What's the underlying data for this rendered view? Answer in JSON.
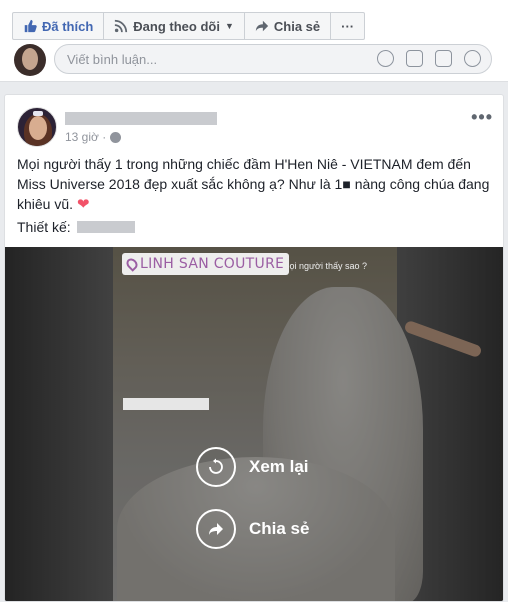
{
  "actions": {
    "like_label": "Đã thích",
    "follow_label": "Đang theo dõi",
    "share_label": "Chia sẻ",
    "more_label": "···"
  },
  "comment": {
    "placeholder": "Viết bình luận..."
  },
  "post": {
    "time": "13 giờ ·",
    "text": "Mọi người thấy 1 trong những chiếc đầm H'Hen Niê - VIETNAM đem đến Miss Universe 2018 đẹp xuất sắc không ạ? Như là 1",
    "text_tail": " nàng công chúa đang khiêu vũ.",
    "design_label": "Thiết kế:",
    "more_label": "•••"
  },
  "video": {
    "tag": "LINH SAN COUTURE",
    "caption": "Mọi người thấy sao ?",
    "replay_label": "Xem lại",
    "share_label": "Chia sẻ"
  },
  "colors": {
    "accent": "#4267b2",
    "heart": "#f25268",
    "tag": "#9b5ea3"
  }
}
